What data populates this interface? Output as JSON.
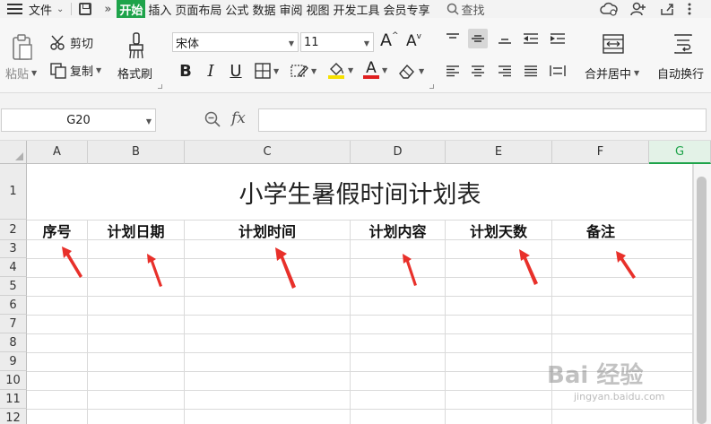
{
  "menu": {
    "file": "文件",
    "tabs": [
      "开始",
      "插入",
      "页面布局",
      "公式",
      "数据",
      "审阅",
      "视图",
      "开发工具",
      "会员专享"
    ],
    "active_tab": "开始",
    "more": "»",
    "search": "查找"
  },
  "ribbon": {
    "paste": "粘贴",
    "cut": "剪切",
    "copy": "复制",
    "format_painter": "格式刷",
    "font_name": "宋体",
    "font_size": "11",
    "grow_font": "A",
    "shrink_font": "A",
    "bold": "B",
    "italic": "I",
    "underline": "U",
    "font_color_letter": "A",
    "merge_center": "合并居中",
    "wrap_text": "自动换行"
  },
  "formula_bar": {
    "cell_ref": "G20",
    "fx": "fx",
    "formula": ""
  },
  "sheet": {
    "columns": [
      "A",
      "B",
      "C",
      "D",
      "E",
      "F",
      "G"
    ],
    "selected_column": "G",
    "rows": [
      "1",
      "2",
      "3",
      "4",
      "5",
      "6",
      "7",
      "8",
      "9",
      "10",
      "11",
      "12"
    ],
    "title": "小学生暑假时间计划表",
    "headers": [
      "序号",
      "计划日期",
      "计划时间",
      "计划内容",
      "计划天数",
      "备注"
    ]
  },
  "watermark": {
    "text": "Bai 经验",
    "url": "jingyan.baidu.com"
  },
  "colors": {
    "accent": "#1ea34a",
    "arrow": "#e8302a"
  }
}
